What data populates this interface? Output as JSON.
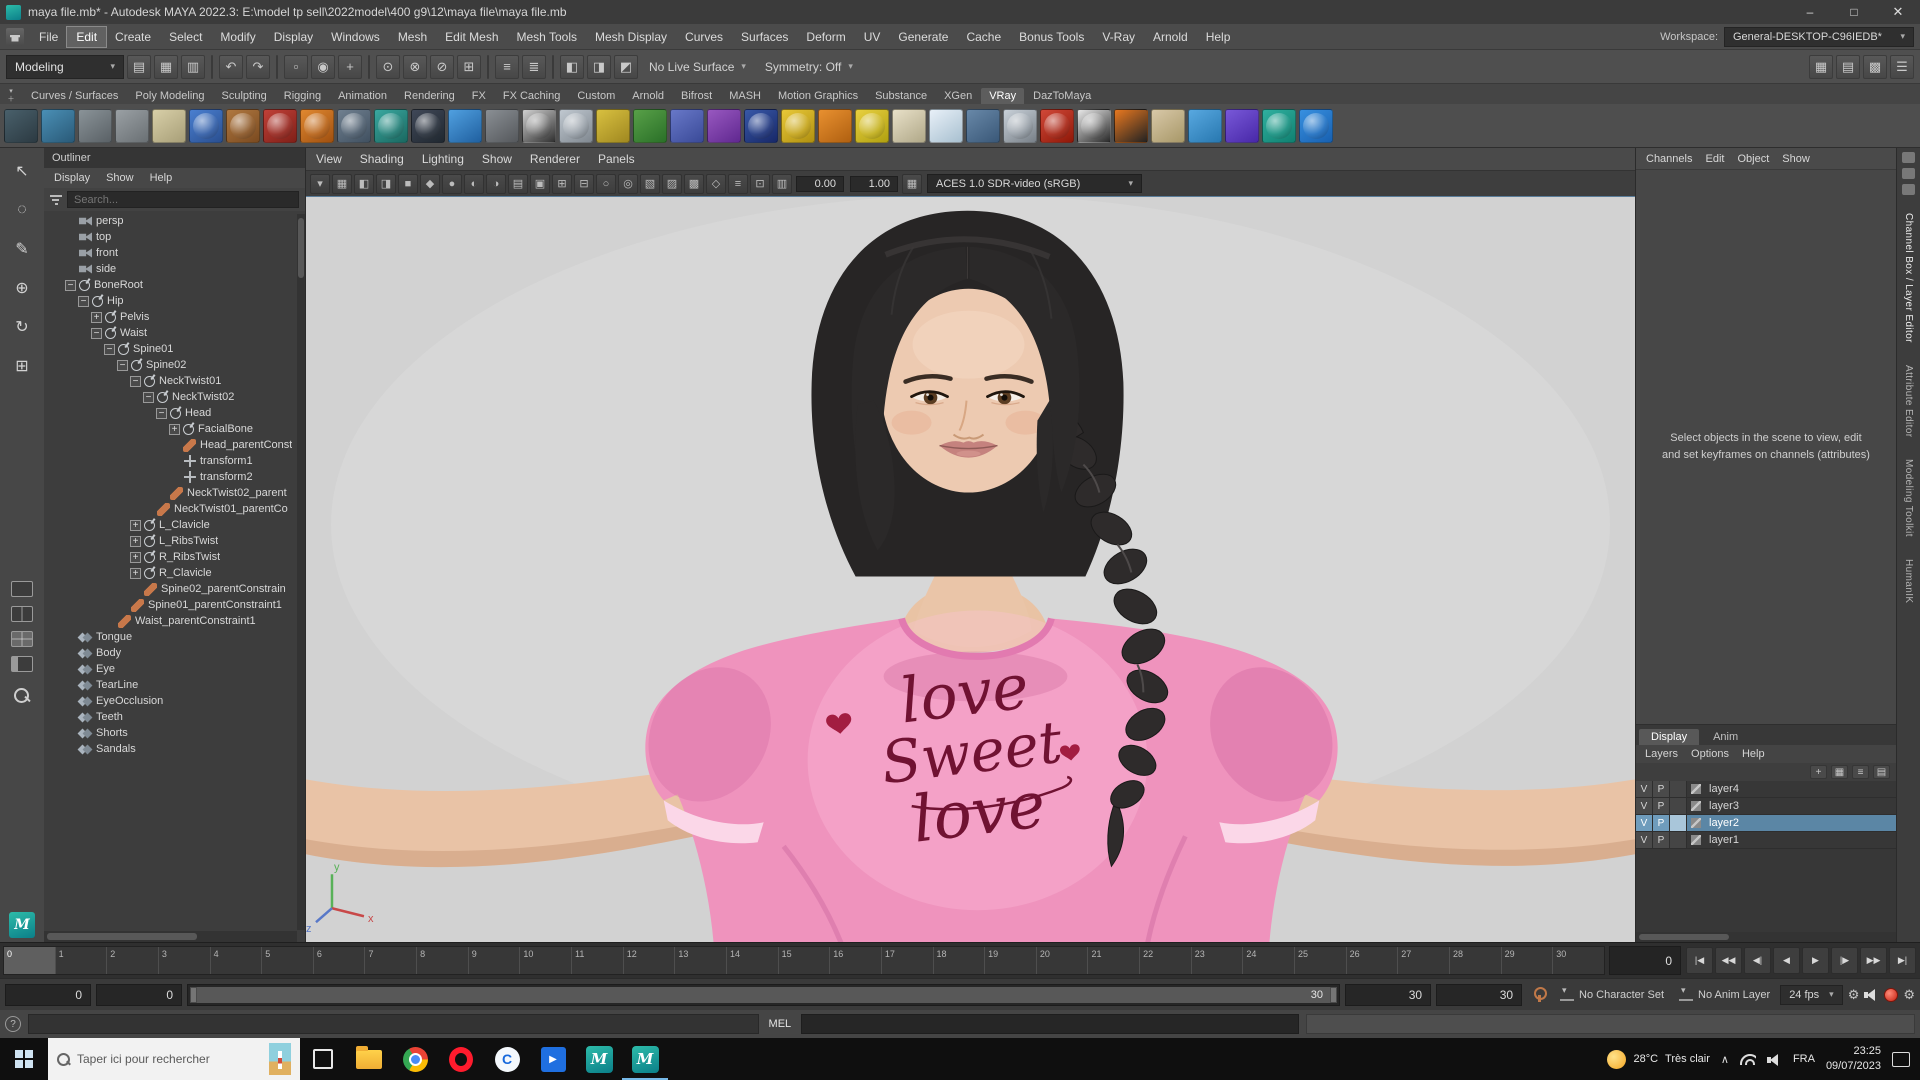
{
  "window": {
    "title": "maya file.mb* - Autodesk MAYA 2022.3:  E:\\model tp sell\\2022model\\400 g9\\12\\maya file\\maya file.mb",
    "min": "–",
    "max": "□",
    "close": "✕"
  },
  "menubar": {
    "items": [
      {
        "label": "File"
      },
      {
        "label": "Edit",
        "cls": "active"
      },
      {
        "label": "Create"
      },
      {
        "label": "Select"
      },
      {
        "label": "Modify"
      },
      {
        "label": "Display"
      },
      {
        "label": "Windows"
      },
      {
        "label": "Mesh"
      },
      {
        "label": "Edit Mesh"
      },
      {
        "label": "Mesh Tools"
      },
      {
        "label": "Mesh Display"
      },
      {
        "label": "Curves"
      },
      {
        "label": "Surfaces"
      },
      {
        "label": "Deform"
      },
      {
        "label": "UV"
      },
      {
        "label": "Generate"
      },
      {
        "label": "Cache"
      },
      {
        "label": "Bonus Tools"
      },
      {
        "label": "V-Ray"
      },
      {
        "label": "Arnold"
      },
      {
        "label": "Help"
      }
    ],
    "workspace_label": "Workspace:",
    "workspace_value": "General-DESKTOP-C96IEDB*"
  },
  "statusline": {
    "mode": "Modeling",
    "live_surface": "No Live Surface",
    "symmetry": "Symmetry: Off",
    "icons": [
      {
        "g": "▤"
      },
      {
        "g": "▦"
      },
      {
        "g": "▥"
      },
      {
        "cls": "sep"
      },
      {
        "g": "↶"
      },
      {
        "g": "↷"
      },
      {
        "cls": "sep"
      },
      {
        "g": "▫"
      },
      {
        "g": "◉"
      },
      {
        "g": "+"
      },
      {
        "cls": "sep"
      },
      {
        "g": "⊙"
      },
      {
        "g": "⊗"
      },
      {
        "g": "⊘"
      },
      {
        "g": "⊞"
      },
      {
        "cls": "sep"
      },
      {
        "g": "≡"
      },
      {
        "g": "≣"
      },
      {
        "cls": "sep"
      },
      {
        "g": "◧"
      },
      {
        "g": "◨"
      },
      {
        "g": "◩"
      }
    ],
    "right_icons": [
      "▦",
      "▤",
      "▩",
      "☰"
    ]
  },
  "shelf": {
    "tabs": [
      {
        "label": "Curves / Surfaces"
      },
      {
        "label": "Poly Modeling"
      },
      {
        "label": "Sculpting"
      },
      {
        "label": "Rigging"
      },
      {
        "label": "Animation"
      },
      {
        "label": "Rendering"
      },
      {
        "label": "FX"
      },
      {
        "label": "FX Caching"
      },
      {
        "label": "Custom"
      },
      {
        "label": "Arnold"
      },
      {
        "label": "Bifrost"
      },
      {
        "label": "MASH"
      },
      {
        "label": "Motion Graphics"
      },
      {
        "label": "Substance"
      },
      {
        "label": "XGen"
      },
      {
        "label": "VRay",
        "cls": "active"
      },
      {
        "label": "DazToMaya"
      }
    ],
    "icons": [
      {
        "vars": {
          "g1": "#49606b",
          "g2": "#2c3a42"
        }
      },
      {
        "vars": {
          "g1": "#4a8fb5",
          "g2": "#2a5a78"
        }
      },
      {
        "vars": {
          "g1": "#8a9398",
          "g2": "#5a6166"
        }
      },
      {
        "vars": {
          "g1": "#9aa0a4",
          "g2": "#6a7074"
        }
      },
      {
        "vars": {
          "g1": "#d8cfa8",
          "g2": "#a89f78"
        }
      },
      {
        "cls": "r",
        "vars": {
          "g1": "#4a7fd0",
          "g2": "#2a4f90"
        }
      },
      {
        "cls": "r",
        "vars": {
          "g1": "#b07840",
          "g2": "#7a4a20"
        }
      },
      {
        "cls": "r",
        "vars": {
          "g1": "#c04038",
          "g2": "#802018"
        }
      },
      {
        "cls": "r",
        "vars": {
          "g1": "#e08830",
          "g2": "#a05010"
        }
      },
      {
        "cls": "r",
        "vars": {
          "g1": "#708090",
          "g2": "#405060"
        }
      },
      {
        "cls": "r",
        "vars": {
          "g1": "#3aa8a0",
          "g2": "#1a6860"
        }
      },
      {
        "cls": "r",
        "vars": {
          "g1": "#404858",
          "g2": "#202830"
        }
      },
      {
        "vars": {
          "g1": "#50a0e0",
          "g2": "#2060a0"
        }
      },
      {
        "vars": {
          "g1": "#8a8f94",
          "g2": "#55585c"
        }
      },
      {
        "cls": "r",
        "vars": {
          "g1": "#d0d0d0",
          "g2": "#303030"
        }
      },
      {
        "cls": "r",
        "vars": {
          "g1": "#c0c8d0",
          "g2": "#808890"
        }
      },
      {
        "vars": {
          "g1": "#d8c040",
          "g2": "#a08820"
        }
      },
      {
        "vars": {
          "g1": "#58a048",
          "g2": "#2a7028"
        }
      },
      {
        "vars": {
          "g1": "#6878c8",
          "g2": "#3a4a98"
        }
      },
      {
        "vars": {
          "g1": "#9858c0",
          "g2": "#602890"
        }
      },
      {
        "cls": "r",
        "vars": {
          "g1": "#3858a8",
          "g2": "#182868"
        }
      },
      {
        "cls": "r",
        "vars": {
          "g1": "#e8c838",
          "g2": "#b09010"
        }
      },
      {
        "vars": {
          "g1": "#e89030",
          "g2": "#b06010"
        }
      },
      {
        "cls": "r",
        "vars": {
          "g1": "#e8d040",
          "g2": "#b0a010"
        }
      },
      {
        "vars": {
          "g1": "#e8e0c8",
          "g2": "#b0a888"
        }
      },
      {
        "vars": {
          "g1": "#e8f0f8",
          "g2": "#a8c0d0"
        }
      },
      {
        "vars": {
          "g1": "#6888a8",
          "g2": "#3a5878"
        }
      },
      {
        "cls": "r",
        "vars": {
          "g1": "#c8d0d8",
          "g2": "#788088"
        }
      },
      {
        "cls": "r",
        "vars": {
          "g1": "#d04838",
          "g2": "#901808"
        }
      },
      {
        "cls": "r",
        "vars": {
          "g1": "#e8e8e8",
          "g2": "#282828"
        }
      },
      {
        "vars": {
          "g1": "#e87820",
          "g2": "#222222"
        }
      },
      {
        "vars": {
          "g1": "#d8c8a8",
          "g2": "#a89868"
        }
      },
      {
        "vars": {
          "g1": "#58a8e0",
          "g2": "#2878b0"
        }
      },
      {
        "vars": {
          "g1": "#7858d8",
          "g2": "#4828a8"
        }
      },
      {
        "cls": "r",
        "vars": {
          "g1": "#30b0a0",
          "g2": "#108070"
        }
      },
      {
        "cls": "r",
        "vars": {
          "g1": "#3890e0",
          "g2": "#1860b0"
        }
      }
    ]
  },
  "toolbox": {
    "tools": [
      "↖",
      "◌",
      "✎",
      "⊕",
      "↻",
      "⊞"
    ]
  },
  "outliner": {
    "title": "Outliner",
    "menus": [
      "Display",
      "Show",
      "Help"
    ],
    "search_placeholder": "Search...",
    "tree": [
      {
        "label": "persp",
        "icon": "camera",
        "vars": {
          "d": 1
        }
      },
      {
        "label": "top",
        "icon": "camera",
        "vars": {
          "d": 1
        }
      },
      {
        "label": "front",
        "icon": "camera",
        "vars": {
          "d": 1
        }
      },
      {
        "label": "side",
        "icon": "camera",
        "vars": {
          "d": 1
        }
      },
      {
        "label": "BoneRoot",
        "icon": "joint",
        "exp": "minus",
        "vars": {
          "d": 1
        }
      },
      {
        "label": "Hip",
        "icon": "joint",
        "exp": "minus",
        "vars": {
          "d": 2
        }
      },
      {
        "label": "Pelvis",
        "icon": "joint",
        "exp": "plus",
        "vars": {
          "d": 3
        }
      },
      {
        "label": "Waist",
        "icon": "joint",
        "exp": "minus",
        "vars": {
          "d": 3
        }
      },
      {
        "label": "Spine01",
        "icon": "joint",
        "exp": "minus",
        "vars": {
          "d": 4
        }
      },
      {
        "label": "Spine02",
        "icon": "joint",
        "exp": "minus",
        "vars": {
          "d": 5
        }
      },
      {
        "label": "NeckTwist01",
        "icon": "joint",
        "exp": "minus",
        "vars": {
          "d": 6
        }
      },
      {
        "label": "NeckTwist02",
        "icon": "joint",
        "exp": "minus",
        "vars": {
          "d": 7
        }
      },
      {
        "label": "Head",
        "icon": "joint",
        "exp": "minus",
        "vars": {
          "d": 8
        }
      },
      {
        "label": "FacialBone",
        "icon": "joint",
        "exp": "plus",
        "vars": {
          "d": 9
        }
      },
      {
        "label": "Head_parentConst",
        "icon": "constraint",
        "vars": {
          "d": 9
        }
      },
      {
        "label": "transform1",
        "icon": "transform",
        "vars": {
          "d": 9
        }
      },
      {
        "label": "transform2",
        "icon": "transform",
        "vars": {
          "d": 9
        }
      },
      {
        "label": "NeckTwist02_parent",
        "icon": "constraint",
        "vars": {
          "d": 8
        }
      },
      {
        "label": "NeckTwist01_parentCo",
        "icon": "constraint",
        "vars": {
          "d": 7
        }
      },
      {
        "label": "L_Clavicle",
        "icon": "joint",
        "exp": "plus",
        "vars": {
          "d": 6
        }
      },
      {
        "label": "L_RibsTwist",
        "icon": "joint",
        "exp": "plus",
        "vars": {
          "d": 6
        }
      },
      {
        "label": "R_RibsTwist",
        "icon": "joint",
        "exp": "plus",
        "vars": {
          "d": 6
        }
      },
      {
        "label": "R_Clavicle",
        "icon": "joint",
        "exp": "plus",
        "vars": {
          "d": 6
        }
      },
      {
        "label": "Spine02_parentConstrain",
        "icon": "constraint",
        "vars": {
          "d": 6
        }
      },
      {
        "label": "Spine01_parentConstraint1",
        "icon": "constraint",
        "vars": {
          "d": 5
        }
      },
      {
        "label": "Waist_parentConstraint1",
        "icon": "constraint",
        "vars": {
          "d": 4
        }
      },
      {
        "label": "Tongue",
        "icon": "mesh",
        "vars": {
          "d": 1
        }
      },
      {
        "label": "Body",
        "icon": "mesh",
        "vars": {
          "d": 1
        }
      },
      {
        "label": "Eye",
        "icon": "mesh",
        "vars": {
          "d": 1
        }
      },
      {
        "label": "TearLine",
        "icon": "mesh",
        "vars": {
          "d": 1
        }
      },
      {
        "label": "EyeOcclusion",
        "icon": "mesh",
        "vars": {
          "d": 1
        }
      },
      {
        "label": "Teeth",
        "icon": "mesh",
        "vars": {
          "d": 1
        }
      },
      {
        "label": "Shorts",
        "icon": "mesh",
        "vars": {
          "d": 1
        }
      },
      {
        "label": "Sandals",
        "icon": "mesh",
        "vars": {
          "d": 1
        }
      }
    ]
  },
  "viewport": {
    "menus": [
      "View",
      "Shading",
      "Lighting",
      "Show",
      "Renderer",
      "Panels"
    ],
    "icons": [
      "▾",
      "▦",
      "◧",
      "◨",
      "■",
      "◆",
      "●",
      "◐",
      "◑",
      "▤",
      "▣",
      "⊞",
      "⊟",
      "○",
      "◎",
      "▧",
      "▨",
      "▩",
      "◇",
      "≡",
      "⊡",
      "▥"
    ],
    "exposure": "0.00",
    "gamma": "1.00",
    "colorspace": "ACES 1.0 SDR-video (sRGB)"
  },
  "scene": {
    "shirt_lines": [
      "love",
      "Sweet",
      "love"
    ],
    "axis": {
      "x": "x",
      "y": "y",
      "z": "z"
    }
  },
  "channel_box": {
    "menus": [
      "Channels",
      "Edit",
      "Object",
      "Show"
    ],
    "empty_text": "Select objects in the scene to view, edit and set keyframes on channels (attributes)"
  },
  "layer_editor": {
    "tabs": [
      {
        "label": "Display",
        "cls": "active"
      },
      {
        "label": "Anim"
      }
    ],
    "menus": [
      "Layers",
      "Options",
      "Help"
    ],
    "icons": [
      "+",
      "▦",
      "≡",
      "▤"
    ],
    "layers": [
      {
        "v": "V",
        "p": "P",
        "name": "layer4"
      },
      {
        "v": "V",
        "p": "P",
        "name": "layer3"
      },
      {
        "v": "V",
        "p": "P",
        "name": "layer2",
        "cls": "selected"
      },
      {
        "v": "V",
        "p": "P",
        "name": "layer1"
      }
    ]
  },
  "right_strip": {
    "labels": [
      {
        "label": "Channel Box / Layer Editor",
        "cls": "active"
      },
      {
        "label": "Attribute Editor"
      },
      {
        "label": "Modeling Toolkit"
      },
      {
        "label": "HumanIK"
      }
    ]
  },
  "timeline": {
    "ticks": [
      {
        "label": "0",
        "cls": "cur"
      },
      "1",
      "2",
      "3",
      "4",
      "5",
      "6",
      "7",
      "8",
      "9",
      "10",
      "11",
      "12",
      "13",
      "14",
      "15",
      "16",
      "17",
      "18",
      "19",
      "20",
      "21",
      "22",
      "23",
      "24",
      "25",
      "26",
      "27",
      "28",
      "29",
      "30"
    ],
    "current_frame": "0",
    "playback": [
      "|◀",
      "◀◀",
      "◀|",
      "◀",
      "▶",
      "|▶",
      "▶▶",
      "▶|"
    ]
  },
  "range_bar": {
    "start": "0",
    "range_start": "0",
    "range_end_label": "30",
    "range_end": "30",
    "end": "30",
    "character_set": "No Character Set",
    "anim_layer": "No Anim Layer",
    "fps": "24 fps"
  },
  "command_line": {
    "label": "MEL"
  },
  "taskbar": {
    "search_placeholder": "Taper ici pour rechercher",
    "apps": [
      {
        "ico": "ic-taskview"
      },
      {
        "ico": "ic-folder"
      },
      {
        "ico": "ic-chrome"
      },
      {
        "ico": "ic-opera"
      },
      {
        "ico": "ic-capcut",
        "g": "C"
      },
      {
        "ico": "ic-films",
        "g": "▶"
      },
      {
        "ico": "ic-maya",
        "g": "M"
      },
      {
        "ico": "ic-maya",
        "g": "M",
        "cls": "active-app"
      }
    ],
    "tray": {
      "temp": "28°C",
      "desc": "Très clair",
      "lang": "FRA",
      "time": "23:25",
      "date": "09/07/2023"
    }
  }
}
